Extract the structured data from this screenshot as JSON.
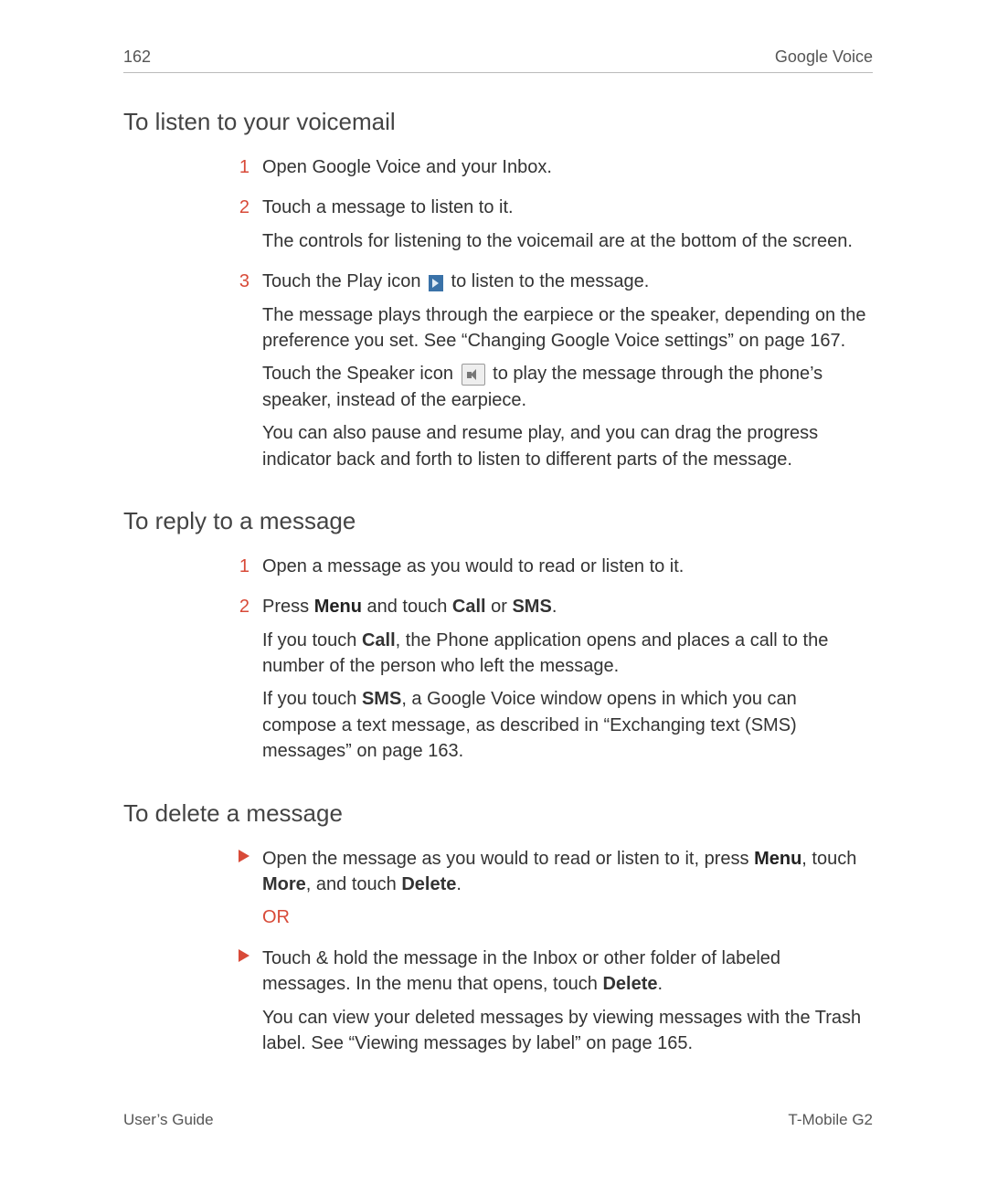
{
  "header": {
    "page_number": "162",
    "section": "Google Voice"
  },
  "sections": [
    {
      "heading": "To listen to your voicemail",
      "steps": [
        {
          "num": "1",
          "paras": [
            "Open Google Voice and your Inbox."
          ]
        },
        {
          "num": "2",
          "paras": [
            "Touch a message to listen to it.",
            "The controls for listening to the voicemail are at the bottom of the screen."
          ]
        },
        {
          "num": "3",
          "paras_html": [
            "Touch the Play icon {PLAY} to listen to the message.",
            "The message plays through the earpiece or the speaker, depending on the preference you set. See “Changing Google Voice settings” on page 167.",
            "Touch the Speaker icon {SPEAKER} to play the message through the phone’s speaker, instead of the earpiece.",
            "You can also pause and resume play, and you can drag the progress indicator back and forth to listen to different parts of the message."
          ]
        }
      ]
    },
    {
      "heading": "To reply to a message",
      "steps": [
        {
          "num": "1",
          "paras": [
            "Open a message as you would to read or listen to it."
          ]
        },
        {
          "num": "2",
          "paras_html": [
            "Press {MENU:Menu} and touch {BOLD:Call} or {BOLD:SMS}.",
            "If you touch {BOLD:Call}, the Phone application opens and places a call to the number of the person who left the message.",
            "If you touch {BOLD:SMS}, a Google Voice window opens in which you can compose a text message, as described in “Exchanging text (SMS) messages” on page 163."
          ]
        }
      ]
    },
    {
      "heading": "To delete a message",
      "bullets": [
        {
          "paras_html": [
            "Open the message as you would to read or listen to it, press {MENU:Menu}, touch {BOLD:More}, and touch {BOLD:Delete}.",
            "{OR:OR}"
          ]
        },
        {
          "paras_html": [
            "Touch & hold the message in the Inbox or other folder of labeled messages. In the menu that opens, touch {BOLD:Delete}.",
            "You can view your deleted messages by viewing messages with the Trash label. See “Viewing messages by label” on page 165."
          ]
        }
      ]
    }
  ],
  "footer": {
    "left": "User’s Guide",
    "right": "T-Mobile G2"
  }
}
